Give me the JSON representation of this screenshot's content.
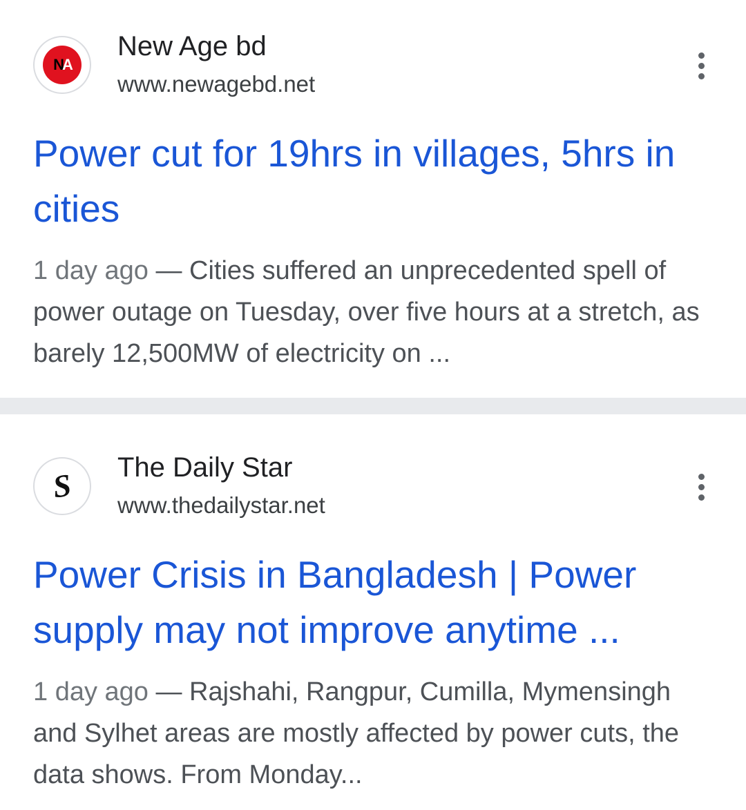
{
  "results": [
    {
      "site_name": "New Age bd",
      "site_url": "www.newagebd.net",
      "favicon": {
        "icon": "newage-logo",
        "letters": [
          "N",
          "A"
        ],
        "color": "#e0121f"
      },
      "title": "Power cut for 19hrs in villages, 5hrs in cities",
      "date": "1 day ago",
      "separator": " — ",
      "snippet": "Cities suffered an unprecedented spell of power outage on Tuesday, over five hours at a stretch, as barely 12,500MW of electricity on ..."
    },
    {
      "site_name": "The Daily Star",
      "site_url": "www.thedailystar.net",
      "favicon": {
        "icon": "dailystar-logo",
        "letters": [
          "S"
        ]
      },
      "title": "Power Crisis in Bangladesh | Power supply may not improve anytime ...",
      "date": "1 day ago",
      "separator": " — ",
      "snippet": "Rajshahi, Rangpur, Cumilla, Mymensingh and Sylhet areas are mostly affected by power cuts, the data shows. From Monday..."
    }
  ],
  "colors": {
    "title_link": "#1a56d6",
    "divider": "#e8eaed"
  },
  "more_icon": "more-vert-icon"
}
